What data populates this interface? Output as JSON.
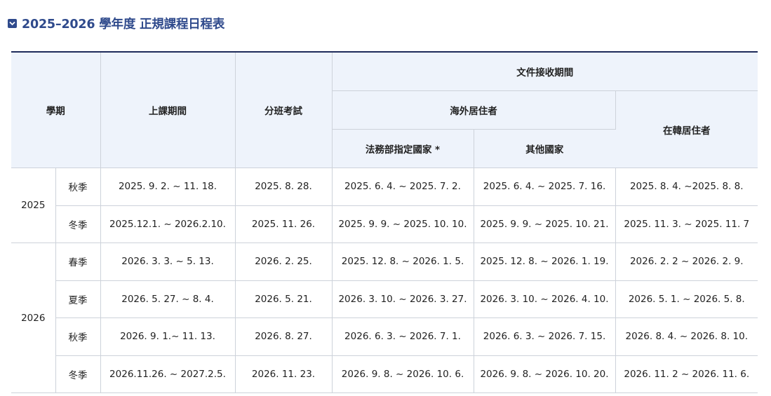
{
  "page": {
    "title": "2025–2026 學年度 正規課程日程表",
    "title_icon": "chevron-down-icon",
    "accent_color": "#2f4a8c"
  },
  "table": {
    "headers": {
      "semester": "學期",
      "class_period": "上課期間",
      "placement_test": "分班考試",
      "doc_period": "文件接收期間",
      "overseas": "海外居住者",
      "moj_countries": "法務部指定國家 *",
      "other_countries": "其他國家",
      "korea_resident": "在韓居住者"
    },
    "groups": [
      {
        "year": "2025",
        "rows": [
          {
            "season": "秋季",
            "class_period": "2025. 9. 2. ~ 11. 18.",
            "test": "2025. 8. 28.",
            "moj": "2025. 6. 4. ~ 2025. 7. 2.",
            "other": "2025. 6. 4. ~ 2025. 7. 16.",
            "korea": "2025. 8. 4. ~2025. 8. 8."
          },
          {
            "season": "冬季",
            "class_period": "2025.12.1. ~ 2026.2.10.",
            "test": "2025. 11. 26.",
            "moj": "2025. 9. 9. ~ 2025. 10. 10.",
            "other": "2025. 9. 9. ~ 2025. 10. 21.",
            "korea": "2025. 11. 3. ~ 2025. 11. 7"
          }
        ]
      },
      {
        "year": "2026",
        "rows": [
          {
            "season": "春季",
            "class_period": "2026. 3. 3. ~ 5. 13.",
            "test": "2026. 2. 25.",
            "moj": "2025. 12. 8. ~ 2026. 1. 5.",
            "other": "2025. 12. 8. ~ 2026. 1. 19.",
            "korea": "2026. 2. 2 ~ 2026. 2. 9."
          },
          {
            "season": "夏季",
            "class_period": "2026. 5. 27. ~ 8. 4.",
            "test": "2026. 5. 21.",
            "moj": "2026. 3. 10. ~ 2026. 3. 27.",
            "other": "2026. 3. 10. ~ 2026. 4. 10.",
            "korea": "2026. 5. 1. ~ 2026. 5. 8."
          },
          {
            "season": "秋季",
            "class_period": "2026. 9. 1.~ 11. 13.",
            "test": "2026. 8. 27.",
            "moj": "2026. 6. 3. ~ 2026. 7. 1.",
            "other": "2026. 6. 3. ~ 2026. 7. 15.",
            "korea": "2026. 8. 4. ~ 2026. 8. 10."
          },
          {
            "season": "冬季",
            "class_period": "2026.11.26. ~ 2027.2.5.",
            "test": "2026. 11. 23.",
            "moj": "2026. 9. 8. ~ 2026. 10. 6.",
            "other": "2026. 9. 8. ~ 2026. 10. 20.",
            "korea": "2026. 11. 2 ~ 2026. 11. 6."
          }
        ]
      }
    ]
  }
}
